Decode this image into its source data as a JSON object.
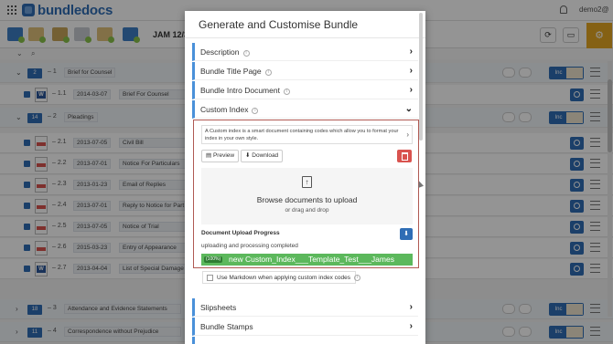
{
  "app": {
    "brand": "bundledocs",
    "user": "demo2@",
    "toolbar_title": "JAM 12/3",
    "colors": {
      "brand": "#2f6db5",
      "accent_gold": "#e5a823",
      "danger": "#d9534f",
      "success": "#5cb85c"
    }
  },
  "rows": [
    {
      "type": "section",
      "badge": "2",
      "num": "1",
      "title": "Brief for Counsel"
    },
    {
      "type": "doc",
      "icon": "word",
      "num": "1.1",
      "date": "2014-03-07",
      "title": "Brief For Counsel"
    },
    {
      "type": "section",
      "badge": "14",
      "num": "2",
      "title": "Pleadings"
    },
    {
      "type": "doc",
      "icon": "pdf",
      "num": "2.1",
      "date": "2013-07-05",
      "title": "Civil Bill"
    },
    {
      "type": "doc",
      "icon": "pdf",
      "num": "2.2",
      "date": "2013-07-01",
      "title": "Notice For Particulars"
    },
    {
      "type": "doc",
      "icon": "pdf",
      "num": "2.3",
      "date": "2013-01-23",
      "title": "Email of Replies"
    },
    {
      "type": "doc",
      "icon": "pdf",
      "num": "2.4",
      "date": "2013-07-01",
      "title": "Reply to Notice for Part"
    },
    {
      "type": "doc",
      "icon": "pdf",
      "num": "2.5",
      "date": "2013-07-05",
      "title": "Notice of Trial"
    },
    {
      "type": "doc",
      "icon": "pdf",
      "num": "2.6",
      "date": "2015-03-23",
      "title": "Entry of Appearance"
    },
    {
      "type": "doc",
      "icon": "word",
      "num": "2.7",
      "date": "2013-04-04",
      "title": "List of Special Damage"
    },
    {
      "type": "section",
      "badge": "18",
      "num": "3",
      "title": "Attendance and Evidence Statements"
    },
    {
      "type": "section",
      "badge": "11",
      "num": "4",
      "title": "Correspondence without Prejudice"
    }
  ],
  "row_inc_label": "Inc",
  "modal": {
    "title": "Generate and Customise Bundle",
    "sections_top": [
      {
        "label": "Description"
      },
      {
        "label": "Bundle Title Page"
      },
      {
        "label": "Bundle Intro Document"
      },
      {
        "label": "Custom Index"
      }
    ],
    "custom_index": {
      "description": "A Custom index is a smart document containing codes which allow you to format your index in your own style.",
      "preview_label": "Preview",
      "download_label": "Download",
      "browse_title": "Browse documents to upload",
      "browse_sub": "or drag and drop",
      "progress_title": "Document Upload Progress",
      "progress_status": "uploading and processing completed",
      "progress_percent_label": "(100%)",
      "progress_value": 1.0,
      "file_name": "new Custom_Index___Template_Test___James"
    },
    "markdown_label": "Use Markdown when applying custom index codes",
    "sections_bottom": [
      {
        "label": "Slipsheets"
      },
      {
        "label": "Bundle Stamps"
      }
    ]
  }
}
